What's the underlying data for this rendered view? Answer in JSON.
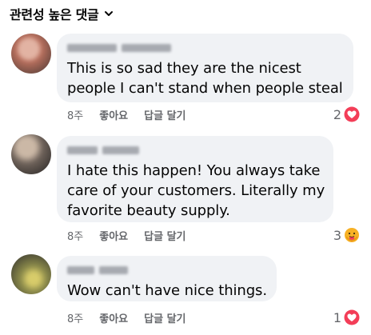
{
  "sort": {
    "label": "관련성 높은 댓글"
  },
  "comments": [
    {
      "lines": [
        "This is so sad they are the nicest",
        "people I can't stand when people steal"
      ],
      "time": "8주",
      "like_label": "좋아요",
      "reply_label": "답글 달기",
      "reaction_count": "2",
      "reaction_icon": "heart-icon",
      "avatar_colors": [
        "#c88978",
        "#7d5a4f",
        "#e9d8d0"
      ]
    },
    {
      "lines": [
        "I hate this happen! You always take",
        "care of your customers. Literally my",
        "favorite beauty supply."
      ],
      "time": "8주",
      "like_label": "좋아요",
      "reply_label": "답글 달기",
      "reaction_count": "3",
      "reaction_icon": "care-icon",
      "avatar_colors": [
        "#5d534e",
        "#b9a99a",
        "#2f2d2c"
      ]
    },
    {
      "lines": [
        "Wow can't have nice things."
      ],
      "time": "8주",
      "like_label": "좋아요",
      "reply_label": "답글 달기",
      "reaction_count": "1",
      "reaction_icon": "heart-icon",
      "avatar_colors": [
        "#7b7a3c",
        "#c2b68a",
        "#3c3a2a"
      ]
    }
  ],
  "colors": {
    "bubble": "#f0f2f5",
    "meta": "#65676b",
    "heart": "#f33e58",
    "care": "#f7b125"
  }
}
